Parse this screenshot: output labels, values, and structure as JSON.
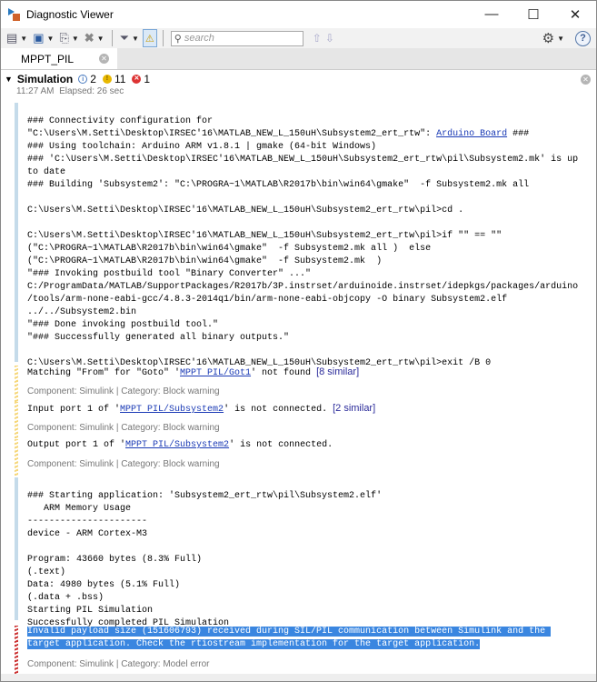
{
  "window": {
    "title": "Diagnostic Viewer",
    "minimize": "—",
    "maximize": "☐",
    "close": "✕"
  },
  "toolbar": {
    "search_placeholder": "search",
    "up": "⇧",
    "down": "⇩",
    "gear": "⚙",
    "help": "?"
  },
  "tab": {
    "label": "MPPT_PIL"
  },
  "simulation": {
    "title": "Simulation",
    "info_count": "2",
    "warn_count": "11",
    "error_count": "1",
    "time": "11:27 AM",
    "elapsed": "Elapsed: 26 sec"
  },
  "block1": {
    "l1": "### Connectivity configuration for",
    "l2a": "\"C:\\Users\\M.Setti\\Desktop\\IRSEC'16\\MATLAB_NEW_L_150uH\\Subsystem2_ert_rtw\": ",
    "l2link": "Arduino Board",
    "l2b": " ###",
    "l3": "### Using toolchain: Arduino ARM v1.8.1 | gmake (64-bit Windows)",
    "l4": "### 'C:\\Users\\M.Setti\\Desktop\\IRSEC'16\\MATLAB_NEW_L_150uH\\Subsystem2_ert_rtw\\pil\\Subsystem2.mk' is up",
    "l5": "to date",
    "l6": "### Building 'Subsystem2': \"C:\\PROGRA~1\\MATLAB\\R2017b\\bin\\win64\\gmake\"  -f Subsystem2.mk all",
    "l7": "",
    "l8": "C:\\Users\\M.Setti\\Desktop\\IRSEC'16\\MATLAB_NEW_L_150uH\\Subsystem2_ert_rtw\\pil>cd .",
    "l9": "",
    "l10": "C:\\Users\\M.Setti\\Desktop\\IRSEC'16\\MATLAB_NEW_L_150uH\\Subsystem2_ert_rtw\\pil>if \"\" == \"\"",
    "l11": "(\"C:\\PROGRA~1\\MATLAB\\R2017b\\bin\\win64\\gmake\"  -f Subsystem2.mk all )  else",
    "l12": "(\"C:\\PROGRA~1\\MATLAB\\R2017b\\bin\\win64\\gmake\"  -f Subsystem2.mk  )",
    "l13": "\"### Invoking postbuild tool \"Binary Converter\" ...\"",
    "l14": "C:/ProgramData/MATLAB/SupportPackages/R2017b/3P.instrset/arduinoide.instrset/idepkgs/packages/arduino",
    "l15": "/tools/arm-none-eabi-gcc/4.8.3-2014q1/bin/arm-none-eabi-objcopy -O binary Subsystem2.elf",
    "l16": "../../Subsystem2.bin",
    "l17": "\"### Done invoking postbuild tool.\"",
    "l18": "\"### Successfully generated all binary outputs.\"",
    "l19": "",
    "l20": "C:\\Users\\M.Setti\\Desktop\\IRSEC'16\\MATLAB_NEW_L_150uH\\Subsystem2_ert_rtw\\pil>exit /B 0"
  },
  "warnings": [
    {
      "pre": "Matching \"From\" for \"Goto\" '",
      "link": "MPPT PIL/Got1",
      "post": "' not found ",
      "similar": "[8 similar]",
      "component": "Component:  Simulink | Category:  Block warning"
    },
    {
      "pre": "Input port 1 of '",
      "link": "MPPT PIL/Subsystem2",
      "post": "' is not connected. ",
      "similar": "[2 similar]",
      "component": "Component:  Simulink | Category:  Block warning"
    },
    {
      "pre": "Output port 1 of '",
      "link": "MPPT PIL/Subsystem2",
      "post": "' is not connected.",
      "similar": "",
      "component": "Component:  Simulink | Category:  Block warning"
    }
  ],
  "block2": {
    "l1": "### Starting application: 'Subsystem2_ert_rtw\\pil\\Subsystem2.elf'",
    "l2": "   ARM Memory Usage",
    "l3": "----------------------",
    "l4": "device - ARM Cortex-M3",
    "l5": "",
    "l6": "Program: 43660 bytes (8.3% Full)",
    "l7": "(.text)",
    "l8": "Data: 4980 bytes (5.1% Full)",
    "l9": "(.data + .bss)",
    "l10": "Starting PIL Simulation",
    "l11": "Successfully completed PIL Simulation"
  },
  "error": {
    "l1": "Invalid payload size (151606793) received during SIL/PIL communication between Simulink and the ",
    "l2": "target application. Check the rtiostream implementation for the target application.",
    "component": "Component:  Simulink | Category:  Model error"
  }
}
